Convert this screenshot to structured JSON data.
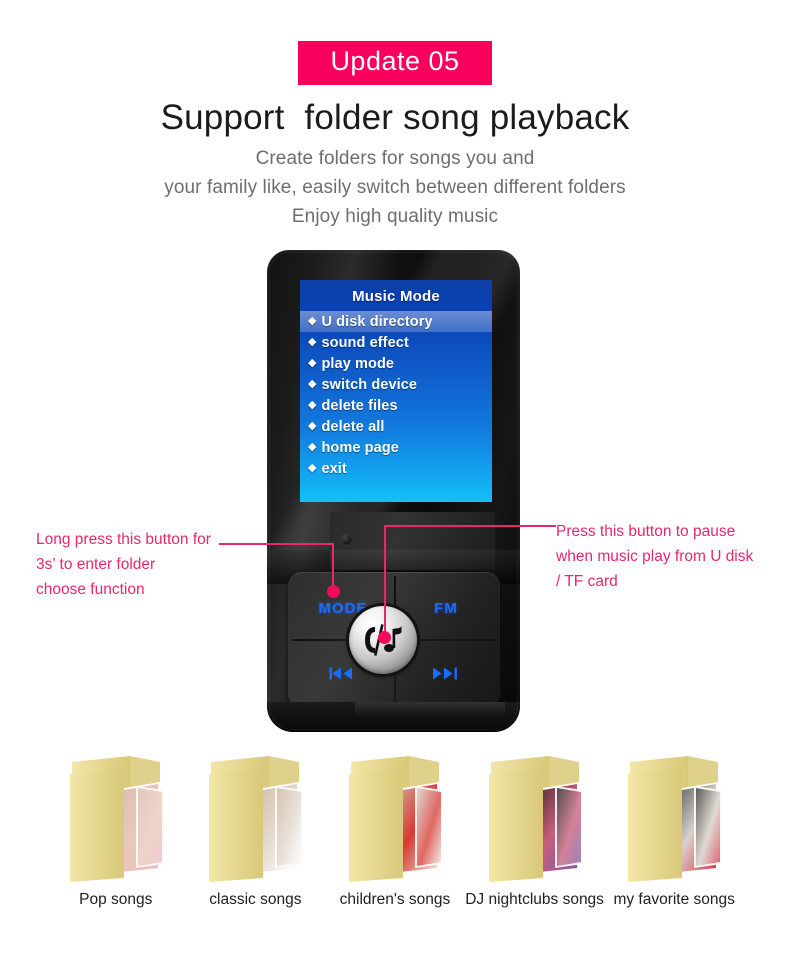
{
  "header": {
    "badge": "Update 05",
    "headline": "Support  folder song playback",
    "sub_line_1": "Create folders for songs you and",
    "sub_line_2": "your family like, easily switch between different folders",
    "sub_line_3": "Enjoy high quality music",
    "badge_color": "#f8005c",
    "headline_color": "#1b1b1b",
    "sub_color": "#6e6e6e"
  },
  "device": {
    "screen": {
      "title": "Music Mode",
      "bullet_glyph": "◆",
      "selected_index": 0,
      "items": [
        "U disk directory",
        "sound effect",
        "play mode",
        "switch device",
        "delete files",
        "delete all",
        "home page",
        "exit"
      ],
      "text_color": "#ffffff",
      "gradient_top": "#0b3fa8",
      "gradient_bottom": "#12c0f8"
    },
    "keys": {
      "mode_label": "MODE",
      "fm_label": "FM",
      "prev_icon": "previous-track-icon",
      "next_icon": "next-track-icon",
      "center_icon": "call-music-icon",
      "label_color": "#1b6bff"
    },
    "mic_icon": "microphone-icon"
  },
  "annotations": {
    "left": "Long press this button for\n3s’  to enter folder\n choose function",
    "right": "Press this button to pause\nwhen music play from U disk\n/ TF card",
    "color": "#e8276c",
    "marker_color": "#f30a5e"
  },
  "folders": [
    {
      "label": "Pop songs",
      "art": "pop",
      "art_colors": [
        "#d8b9a8",
        "#e9c8bb",
        "#f0b8c0"
      ]
    },
    {
      "label": "classic songs",
      "art": "classic",
      "art_colors": [
        "#cbb49a",
        "#e3d9cf",
        "#ffffff"
      ]
    },
    {
      "label": "children's songs",
      "art": "children",
      "art_colors": [
        "#d7cfc6",
        "#d63a33",
        "#efe7df"
      ]
    },
    {
      "label": "DJ nightclubs songs",
      "art": "dj",
      "art_colors": [
        "#1b1b1b",
        "#c95d7a",
        "#7a5ba8"
      ]
    },
    {
      "label": "my favorite songs",
      "art": "favorite",
      "art_colors": [
        "#2a2a2a",
        "#d8d2c8",
        "#d4324a"
      ]
    }
  ],
  "folder_body_color": "#f2e6a8",
  "folder_edge_color": "#d9c878"
}
